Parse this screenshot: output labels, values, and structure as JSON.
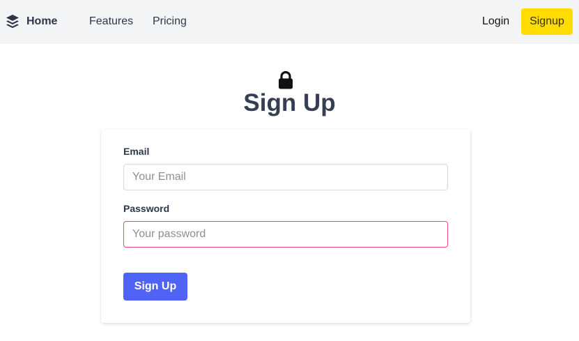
{
  "navbar": {
    "brand": {
      "icon": "layers-icon",
      "label": "Home"
    },
    "links": {
      "features": "Features",
      "pricing": "Pricing"
    },
    "login_label": "Login",
    "signup_label": "Signup",
    "signup_color": "#ffdd00",
    "background_color": "#f3f4f6"
  },
  "header": {
    "icon": "lock-icon",
    "title": "Sign Up"
  },
  "form": {
    "email": {
      "label": "Email",
      "placeholder": "Your Email",
      "value": ""
    },
    "password": {
      "label": "Password",
      "placeholder": "Your password",
      "value": "",
      "border_color": "#f14668"
    },
    "submit_label": "Sign Up",
    "submit_color": "#4f63f5"
  }
}
